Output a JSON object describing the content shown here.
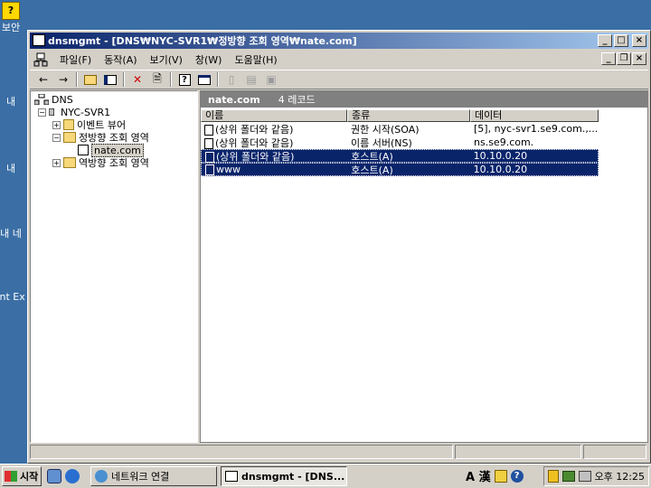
{
  "desktop": {
    "icons": [
      "보안",
      "내",
      "내 ",
      "내 네",
      "Int Ex"
    ]
  },
  "window": {
    "title": "dnsmgmt - [DNS₩NYC-SVR1₩정방향 조회 영역₩nate.com]",
    "menu": [
      "파일(F)",
      "동작(A)",
      "보기(V)",
      "창(W)",
      "도움말(H)"
    ]
  },
  "tree": {
    "root": "DNS",
    "server": "NYC-SVR1",
    "event_viewer": "이벤트 뷰어",
    "forward_zone": "정방향 조회 영역",
    "zone_selected": "nate.com",
    "reverse_zone": "역방향 조회 영역"
  },
  "right_panel": {
    "zone_name": "nate.com",
    "record_count": "4 레코드",
    "columns": [
      "이름",
      "종류",
      "데이터"
    ],
    "rows": [
      {
        "name": "(상위 폴더와 같음)",
        "type": "권한 시작(SOA)",
        "data": "[5], nyc-svr1.se9.com.,...",
        "selected": false
      },
      {
        "name": "(상위 폴더와 같음)",
        "type": "이름 서버(NS)",
        "data": "ns.se9.com.",
        "selected": false
      },
      {
        "name": "(상위 폴더와 같음)",
        "type": "호스트(A)",
        "data": "10.10.0.20",
        "selected": true
      },
      {
        "name": "www",
        "type": "호스트(A)",
        "data": "10.10.0.20",
        "selected": true
      }
    ]
  },
  "taskbar": {
    "start": "시작",
    "tasks": [
      "네트워크 연결",
      "dnsmgmt - [DNS..."
    ],
    "ime": "A 漢",
    "clock": "오후 12:25"
  }
}
